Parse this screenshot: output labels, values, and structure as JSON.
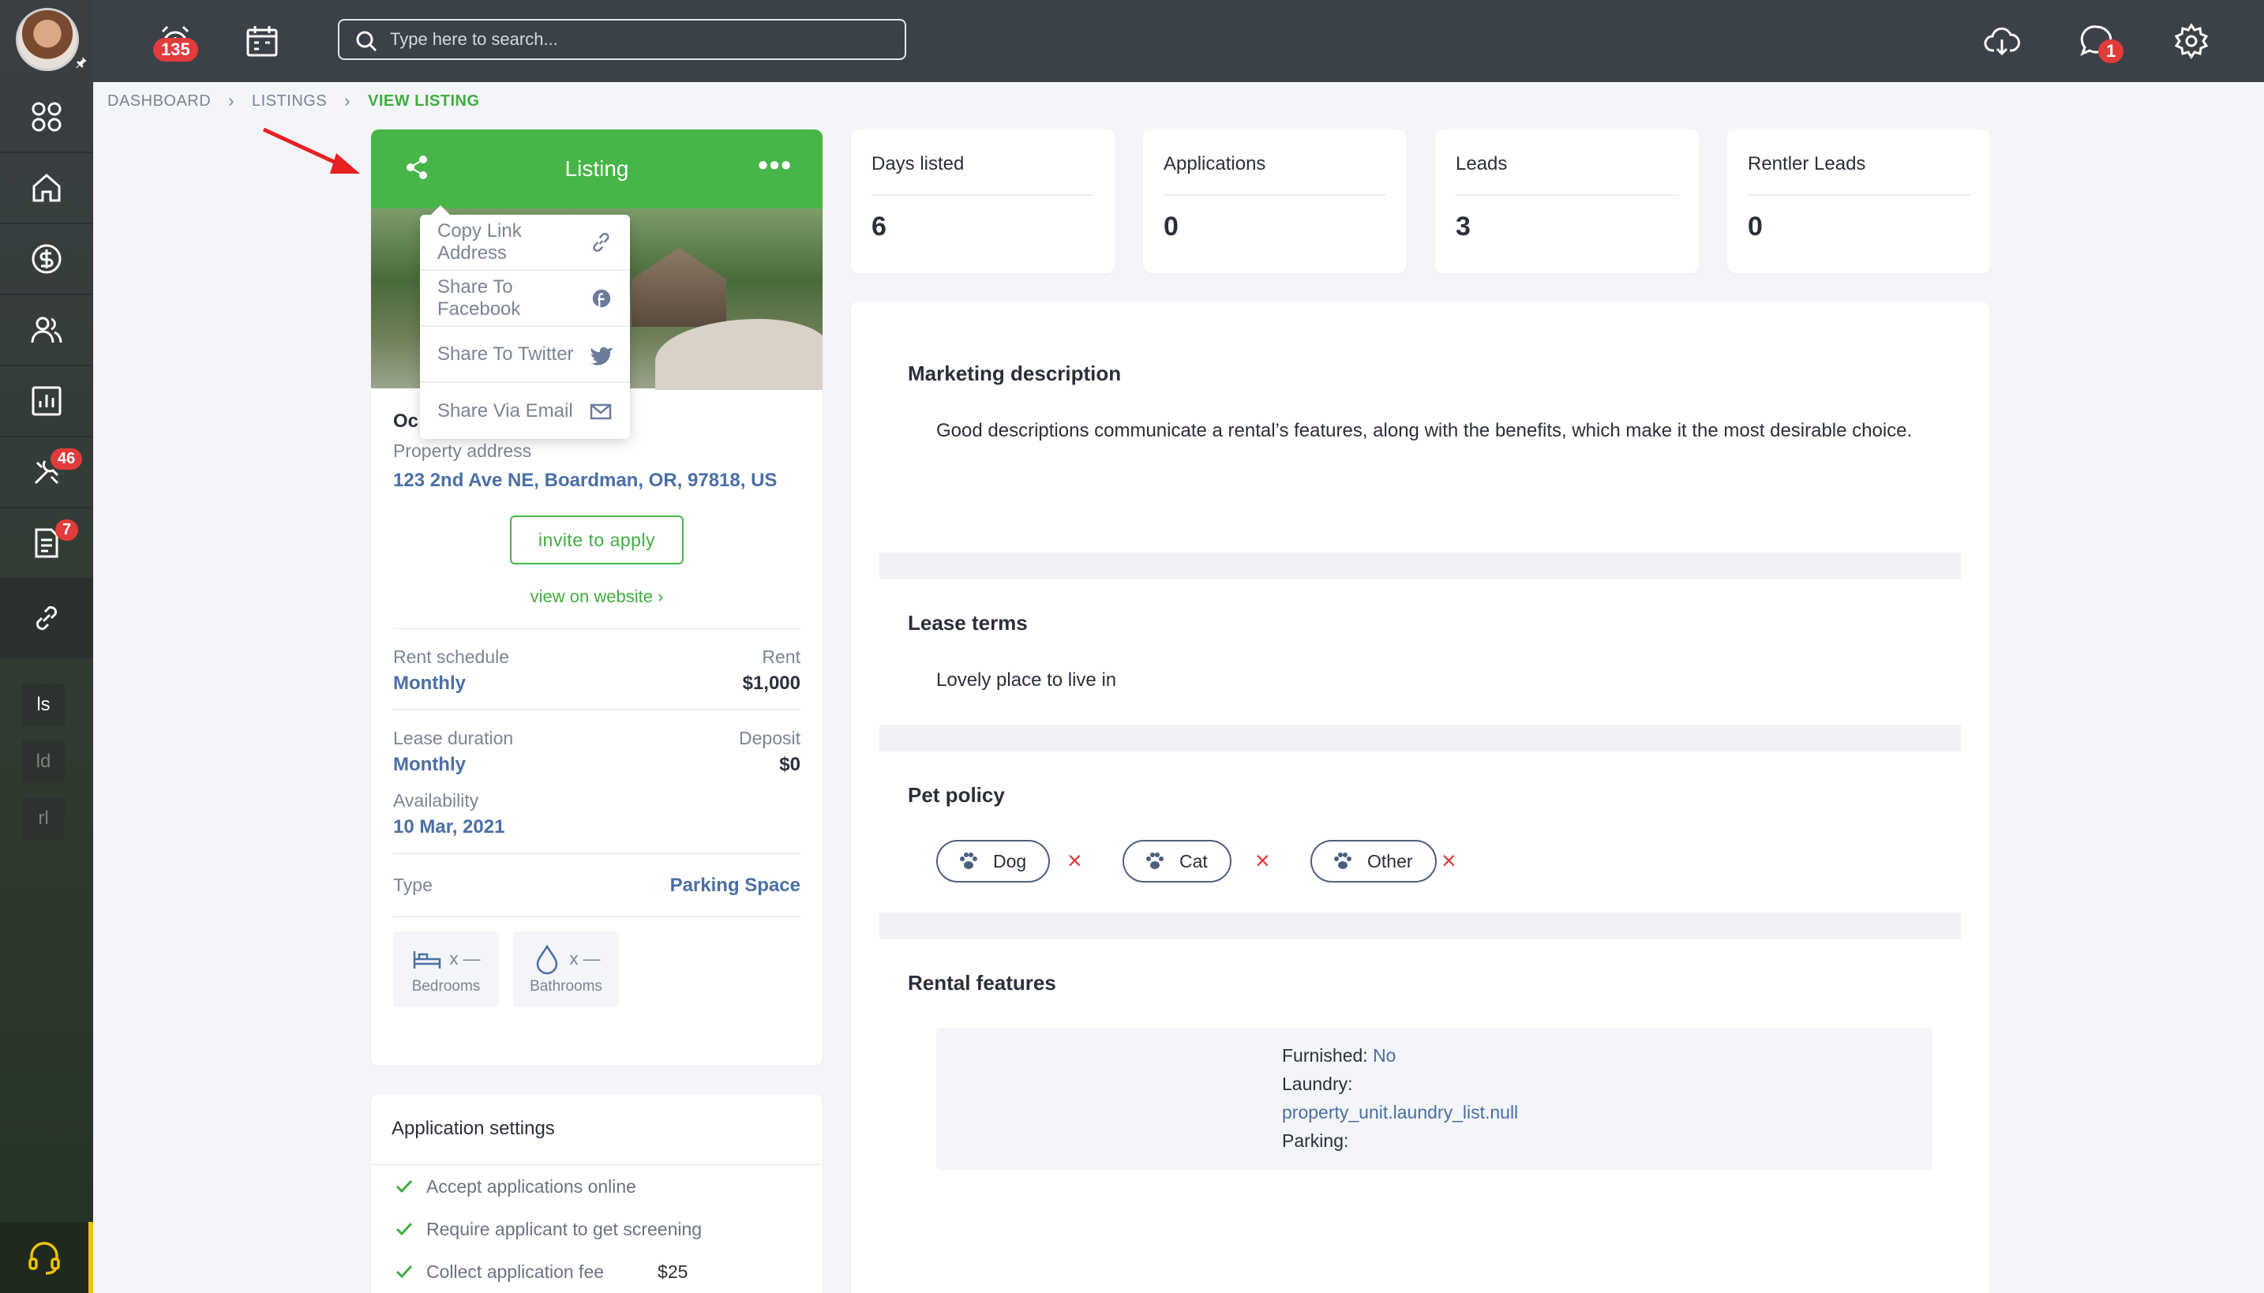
{
  "topbar": {
    "alarm_badge": "135",
    "messages_badge": "1",
    "search_placeholder": "Type here to search..."
  },
  "sidebar": {
    "tools_badge": "46",
    "docs_badge": "7",
    "mini_items": [
      "ls",
      "ld",
      "rl"
    ]
  },
  "breadcrumb": {
    "items": [
      "DASHBOARD",
      "LISTINGS"
    ],
    "current": "VIEW LISTING"
  },
  "listing": {
    "header_title": "Listing",
    "name_partial": "Oc",
    "address_label": "Property address",
    "address": "123 2nd Ave NE, Boardman, OR, 97818, US",
    "invite_label": "invite to apply",
    "website_link": "view on website ›",
    "rent_schedule_label": "Rent schedule",
    "rent_schedule_value": "Monthly",
    "rent_label": "Rent",
    "rent_value": "$1,000",
    "lease_duration_label": "Lease duration",
    "lease_duration_value": "Monthly",
    "deposit_label": "Deposit",
    "deposit_value": "$0",
    "availability_label": "Availability",
    "availability_value": "10 Mar, 2021",
    "type_label": "Type",
    "type_value": "Parking Space",
    "bedrooms_value": "x —",
    "bedrooms_label": "Bedrooms",
    "bathrooms_value": "x —",
    "bathrooms_label": "Bathrooms"
  },
  "share_menu": {
    "items": [
      "Copy Link Address",
      "Share To Facebook",
      "Share To Twitter",
      "Share Via Email"
    ]
  },
  "application_settings": {
    "title": "Application settings",
    "items": [
      "Accept applications online",
      "Require applicant to get screening",
      "Collect application fee"
    ],
    "fee": "$25"
  },
  "stats": [
    {
      "label": "Days listed",
      "value": "6"
    },
    {
      "label": "Applications",
      "value": "0"
    },
    {
      "label": "Leads",
      "value": "3"
    },
    {
      "label": "Rentler Leads",
      "value": "0"
    }
  ],
  "details": {
    "marketing_title": "Marketing description",
    "marketing_text": "Good descriptions communicate a rental’s features, along with the benefits, which make it the most desirable choice.",
    "lease_title": "Lease terms",
    "lease_text": "Lovely place to live in",
    "pet_title": "Pet policy",
    "pets": [
      "Dog",
      "Cat",
      "Other"
    ],
    "features_title": "Rental features",
    "furnished_label": "Furnished:",
    "furnished_value": "No",
    "laundry_label": "Laundry:",
    "laundry_value": "property_unit.laundry_list.null",
    "parking_label": "Parking:"
  },
  "colors": {
    "accent_green": "#47b548",
    "topbar": "#3a4148",
    "badge_red": "#e23b3b",
    "link_blue": "#4a6fa5"
  }
}
